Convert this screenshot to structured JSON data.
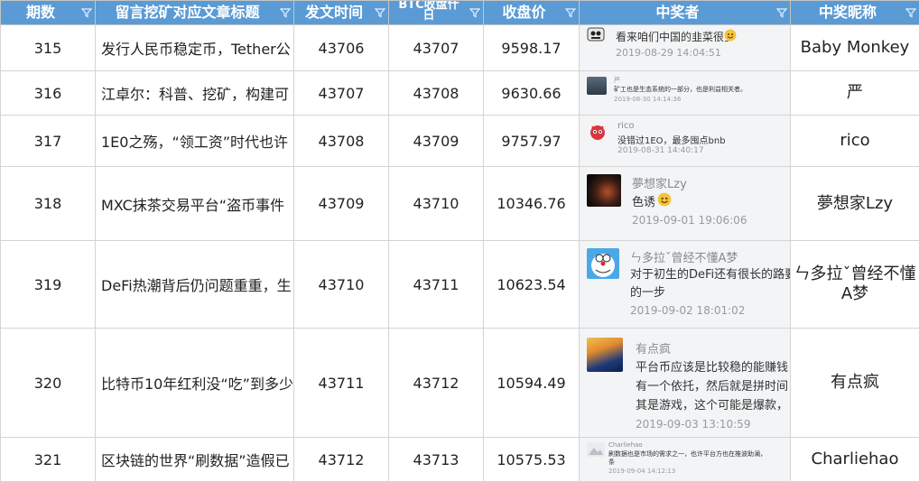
{
  "header": {
    "col_issue": "期数",
    "col_title": "留言挖矿对应文章标题",
    "col_post_time": "发文时间",
    "col_btc_line1": "BTC收盘什",
    "col_btc_line2": "日",
    "col_close": "收盘价",
    "col_winner": "中奖者",
    "col_nickname": "中奖昵称"
  },
  "icons": {
    "filter": "filter-dropdown-icon"
  },
  "colors": {
    "header_bg": "#5b9bd5",
    "grid": "#d4d4d4"
  },
  "rows": [
    {
      "issue": "315",
      "title": "发行人民币稳定币，Tether公",
      "post_time": "43706",
      "btc_day": "43707",
      "close": "9598.17",
      "winner_user": "",
      "winner_text": "看来咱们中国的韭菜很多",
      "winner_time": "2019-08-29 14:04:51",
      "nickname": "Baby Monkey"
    },
    {
      "issue": "316",
      "title": "江卓尔：科普、挖矿，构建可",
      "post_time": "43707",
      "btc_day": "43708",
      "close": "9630.66",
      "winner_user": "严",
      "winner_text": "矿工也是生态系统的一部分，也是利益相关者。",
      "winner_time": "2019-08-30 14:14:36",
      "nickname": "严"
    },
    {
      "issue": "317",
      "title": "1E0之殇，“领工资”时代也许",
      "post_time": "43708",
      "btc_day": "43709",
      "close": "9757.97",
      "winner_user": "rico",
      "winner_text": "没错过1EO，最多囤点bnb",
      "winner_time": "2019-08-31 14:40:17",
      "nickname": "rico"
    },
    {
      "issue": "318",
      "title": "MXC抹茶交易平台“盗币事件",
      "post_time": "43709",
      "btc_day": "43710",
      "close": "10346.76",
      "winner_user": "夢想家Lzy",
      "winner_text": "色诱",
      "winner_time": "2019-09-01 19:06:06",
      "nickname": "夢想家Lzy"
    },
    {
      "issue": "319",
      "title": "DeFi热潮背后仍问题重重，生",
      "post_time": "43710",
      "btc_day": "43711",
      "close": "10623.54",
      "winner_user": "ㄣ多拉ˇ曾经不懂A梦",
      "winner_text": "对于初生的DeFi还有很长的路要",
      "winner_text2": "的一步",
      "winner_time": "2019-09-02 18:01:02",
      "nickname": "ㄣ多拉ˇ曾经不懂A梦"
    },
    {
      "issue": "320",
      "title": "比特币10年红利没“吃”到多少",
      "post_time": "43711",
      "btc_day": "43712",
      "close": "10594.49",
      "winner_user": "有点疯",
      "winner_text": "平台币应该是比较稳的能赚钱",
      "winner_text2": "有一个依托，然后就是拼时间",
      "winner_text3": "其是游戏，这个可能是爆款，",
      "winner_time": "2019-09-03 13:10:59",
      "nickname": "有点疯"
    },
    {
      "issue": "321",
      "title": "区块链的世界“刷数据”造假已",
      "post_time": "43712",
      "btc_day": "43713",
      "close": "10575.53",
      "winner_user": "Charliehao",
      "winner_text": "刷数据也是市场的需求之一，也许平台方也在推波助澜，",
      "winner_text2": "条",
      "winner_time": "2019-09-04 14:12:13",
      "nickname": "Charliehao"
    }
  ]
}
